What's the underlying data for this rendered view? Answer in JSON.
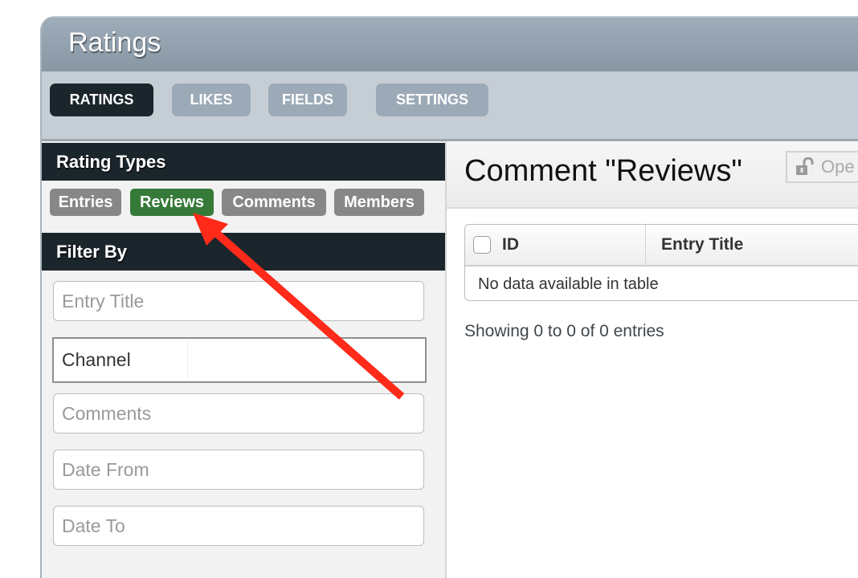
{
  "header": {
    "title": "Ratings"
  },
  "nav_tabs": [
    {
      "label": "RATINGS",
      "active": true
    },
    {
      "label": "LIKES",
      "active": false
    },
    {
      "label": "FIELDS",
      "active": false
    },
    {
      "label": "SETTINGS",
      "active": false
    }
  ],
  "sidebar": {
    "rating_types_heading": "Rating Types",
    "rating_types": [
      {
        "label": "Entries",
        "active": false
      },
      {
        "label": "Reviews",
        "active": true
      },
      {
        "label": "Comments",
        "active": false
      },
      {
        "label": "Members",
        "active": false
      }
    ],
    "filter_heading": "Filter By",
    "filters": {
      "entry_title_placeholder": "Entry Title",
      "channel_value": "Channel",
      "comments_placeholder": "Comments",
      "date_from_placeholder": "Date From",
      "date_to_placeholder": "Date To"
    }
  },
  "main": {
    "title": "Comment \"Reviews\"",
    "open_button_label": "Ope",
    "table": {
      "columns": [
        "ID",
        "Entry Title"
      ],
      "empty_message": "No data available in table"
    },
    "info": "Showing 0 to 0 of 0 entries"
  },
  "annotation": {
    "type": "arrow",
    "color": "#ff2a1a",
    "points_to": "Reviews"
  },
  "colors": {
    "active_tab": "#1b252c",
    "inactive_tab": "#9caab8",
    "active_pill": "#357a38",
    "inactive_pill": "#878787"
  }
}
